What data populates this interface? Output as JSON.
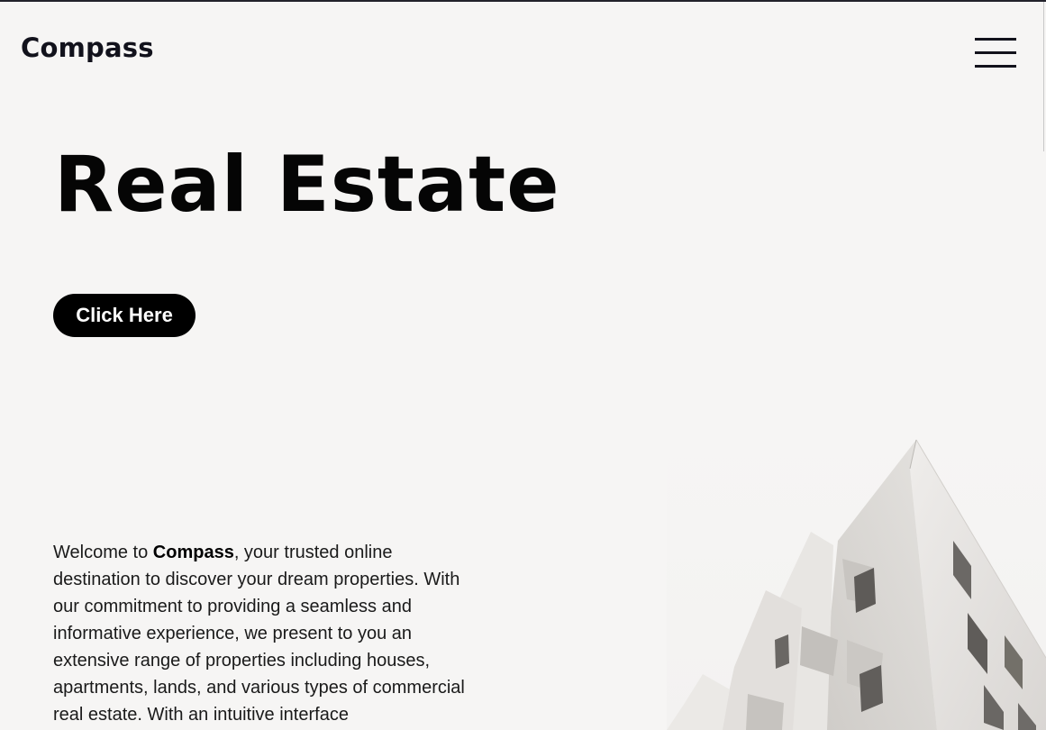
{
  "header": {
    "brand": "Compass",
    "menu_icon": "hamburger-menu-icon"
  },
  "hero": {
    "title": "Real Estate",
    "cta_label": "Click Here"
  },
  "intro": {
    "prefix": "Welcome to ",
    "brand": "Compass",
    "body": ", your trusted online destination to discover your dream properties. With our commitment to providing a seamless and informative experience, we present to you an extensive range of properties including houses, apartments, lands, and various types of commercial real estate. With an intuitive interface"
  },
  "colors": {
    "background": "#f6f5f4",
    "text": "#12121c",
    "button_bg": "#000000",
    "button_text": "#ffffff"
  }
}
